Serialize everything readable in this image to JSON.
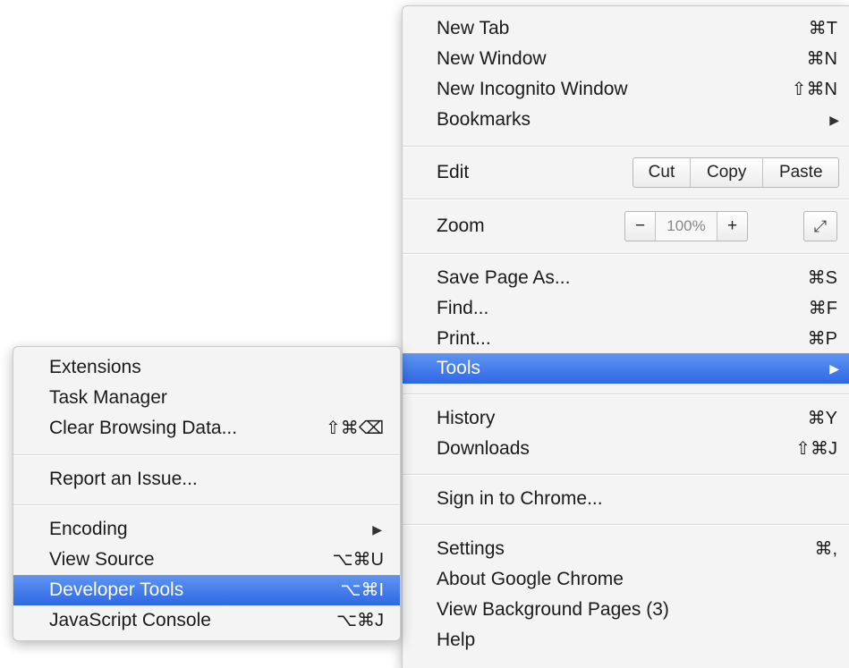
{
  "main_menu": {
    "new_tab": {
      "label": "New Tab",
      "shortcut": "⌘T"
    },
    "new_window": {
      "label": "New Window",
      "shortcut": "⌘N"
    },
    "new_incognito": {
      "label": "New Incognito Window",
      "shortcut": "⇧⌘N"
    },
    "bookmarks": {
      "label": "Bookmarks",
      "arrow": "▶"
    },
    "edit": {
      "label": "Edit",
      "cut": "Cut",
      "copy": "Copy",
      "paste": "Paste"
    },
    "zoom": {
      "label": "Zoom",
      "minus": "−",
      "value": "100%",
      "plus": "+",
      "fullscreen_icon": "⤢"
    },
    "save_page": {
      "label": "Save Page As...",
      "shortcut": "⌘S"
    },
    "find": {
      "label": "Find...",
      "shortcut": "⌘F"
    },
    "print": {
      "label": "Print...",
      "shortcut": "⌘P"
    },
    "tools": {
      "label": "Tools",
      "arrow": "▶"
    },
    "history": {
      "label": "History",
      "shortcut": "⌘Y"
    },
    "downloads": {
      "label": "Downloads",
      "shortcut": "⇧⌘J"
    },
    "sign_in": {
      "label": "Sign in to Chrome..."
    },
    "settings": {
      "label": "Settings",
      "shortcut": "⌘,"
    },
    "about": {
      "label": "About Google Chrome"
    },
    "background_pages": {
      "label": "View Background Pages (3)"
    },
    "help": {
      "label": "Help"
    }
  },
  "tools_submenu": {
    "extensions": {
      "label": "Extensions"
    },
    "task_manager": {
      "label": "Task Manager"
    },
    "clear_browsing": {
      "label": "Clear Browsing Data...",
      "shortcut": "⇧⌘⌫"
    },
    "report_issue": {
      "label": "Report an Issue..."
    },
    "encoding": {
      "label": "Encoding",
      "arrow": "▶"
    },
    "view_source": {
      "label": "View Source",
      "shortcut": "⌥⌘U"
    },
    "developer_tools": {
      "label": "Developer Tools",
      "shortcut": "⌥⌘I"
    },
    "js_console": {
      "label": "JavaScript Console",
      "shortcut": "⌥⌘J"
    }
  },
  "colors": {
    "highlight": "#3b74e8",
    "menu_bg": "#f4f4f4"
  }
}
